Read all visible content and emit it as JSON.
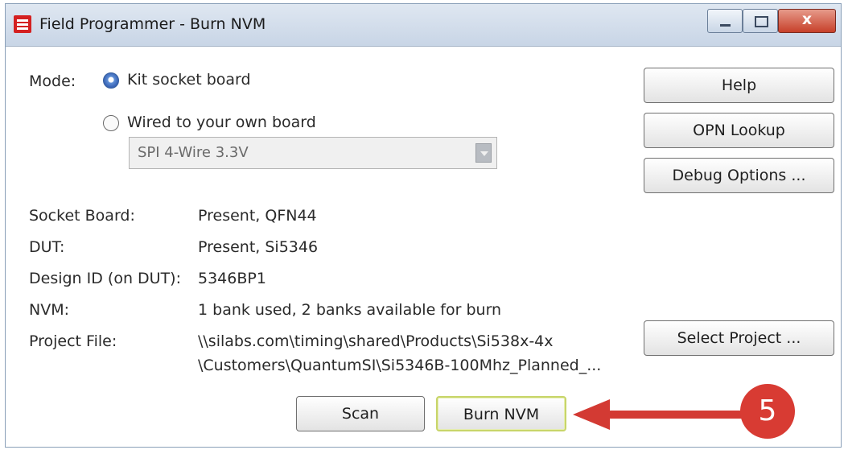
{
  "window": {
    "title": "Field Programmer - Burn NVM",
    "close_label": "x"
  },
  "mode": {
    "label": "Mode:",
    "options": [
      {
        "label": "Kit socket board",
        "selected": true
      },
      {
        "label": "Wired to your own board",
        "selected": false
      }
    ],
    "interface_select": {
      "value": "SPI 4-Wire 3.3V"
    }
  },
  "info": {
    "rows": [
      {
        "label": "Socket Board:",
        "value": "Present, QFN44"
      },
      {
        "label": "DUT:",
        "value": "Present, Si5346"
      },
      {
        "label": "Design ID (on DUT):",
        "value": "5346BP1"
      },
      {
        "label": "NVM:",
        "value": "1 bank used, 2 banks available for burn"
      },
      {
        "label": "Project File:",
        "value_line1": "\\\\silabs.com\\timing\\shared\\Products\\Si538x-4x",
        "value_line2": "\\Customers\\QuantumSI\\Si5346B-100Mhz_Planned_..."
      }
    ]
  },
  "buttons": {
    "help": "Help",
    "opn_lookup": "OPN Lookup",
    "debug_options": "Debug Options ...",
    "select_project": "Select Project ...",
    "scan": "Scan",
    "burn_nvm": "Burn NVM"
  },
  "annotation": {
    "step_number": "5",
    "color": "#d83b33"
  }
}
